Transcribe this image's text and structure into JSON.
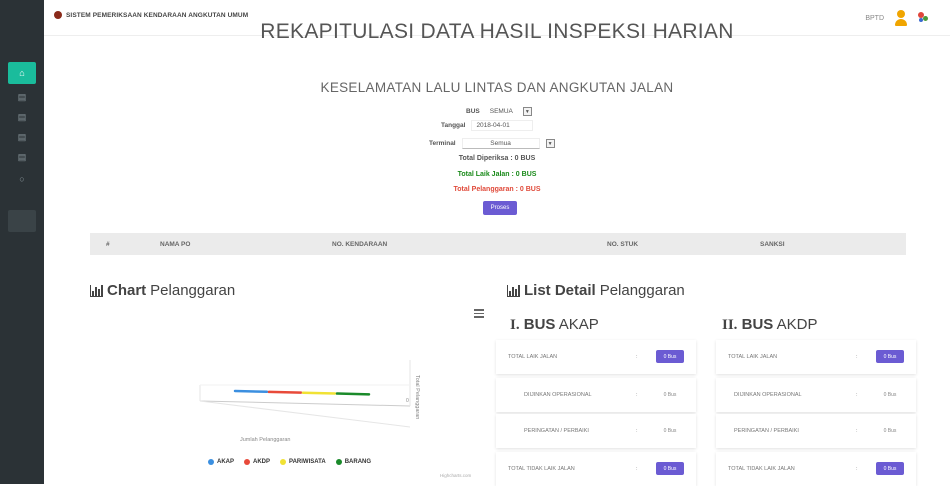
{
  "header": {
    "app_title": "SISTEM PEMERIKSAAN KENDARAAN ANGKUTAN UMUM",
    "user_label": "BPTD"
  },
  "page": {
    "title": "REKAPITULASI DATA HASIL INSPEKSI HARIAN",
    "subtitle": "KESELAMATAN LALU LINTAS DAN ANGKUTAN JALAN"
  },
  "filters": {
    "bus_label": "BUS",
    "bus_value": "SEMUA",
    "tanggal_label": "Tanggal",
    "tanggal_value": "2018-04-01",
    "terminal_label": "Terminal",
    "terminal_value": "Semua"
  },
  "totals": {
    "diperiksa": "Total Diperiksa : 0 BUS",
    "laik_jalan": "Total Laik Jalan : 0 BUS",
    "pelanggaran": "Total Pelanggaran : 0 BUS"
  },
  "colors": {
    "laik_green": "#1a8a1a",
    "pelanggaran_red": "#e04a3a",
    "accent_purple": "#6b5bd3",
    "sidebar_bg": "#2b3236",
    "sidebar_active": "#1abc9c"
  },
  "proses_button": "Proses",
  "table": {
    "columns": [
      "#",
      "NAMA PO",
      "NO. KENDARAAN",
      "NO. STUK",
      "SANKSI"
    ]
  },
  "chart_panel": {
    "title_bold": "Chart",
    "title_rest": "Pelanggaran",
    "x_axis_label": "Jumlah Pelanggaran",
    "y_axis_label": "Total Pelanggaran",
    "credit": "Highcharts.com"
  },
  "chart_data": {
    "type": "line",
    "title": "",
    "xlabel": "Jumlah Pelanggaran",
    "ylabel": "Total Pelanggaran",
    "series": [
      {
        "name": "AKAP",
        "color": "#3b8fe0",
        "values": [
          0
        ]
      },
      {
        "name": "AKDP",
        "color": "#e84a3a",
        "values": [
          0
        ]
      },
      {
        "name": "PARIWISATA",
        "color": "#f1e234",
        "values": [
          0
        ]
      },
      {
        "name": "BARANG",
        "color": "#1a8a2a",
        "values": [
          0
        ]
      }
    ],
    "legend": "bottom"
  },
  "list_panel": {
    "title_bold": "List Detail",
    "title_rest": "Pelanggaran",
    "akap_roman": "I.",
    "akap_bold": "BUS",
    "akap_rest": "AKAP",
    "akdp_roman": "II.",
    "akdp_bold": "BUS",
    "akdp_rest": "AKDP",
    "akap_rows": [
      {
        "label": "TOTAL LAIK JALAN",
        "colon": ":",
        "value": "0 Bus"
      },
      {
        "label": "DIIJINKAN OPERASIONAL",
        "colon": ":",
        "value": "0 Bus"
      },
      {
        "label": "PERINGATAN / PERBAIKI",
        "colon": ":",
        "value": "0 Bus"
      },
      {
        "label": "TOTAL TIDAK LAIK JALAN",
        "colon": ":",
        "value": "0 Bus"
      }
    ],
    "akdp_rows": [
      {
        "label": "TOTAL LAIK JALAN",
        "colon": ":",
        "value": "0 Bus"
      },
      {
        "label": "DIIJINKAN OPERASIONAL",
        "colon": ":",
        "value": "0 Bus"
      },
      {
        "label": "PERINGATAN / PERBAIKI",
        "colon": ":",
        "value": "0 Bus"
      },
      {
        "label": "TOTAL TIDAK LAIK JALAN",
        "colon": ":",
        "value": "0 Bus"
      }
    ]
  }
}
